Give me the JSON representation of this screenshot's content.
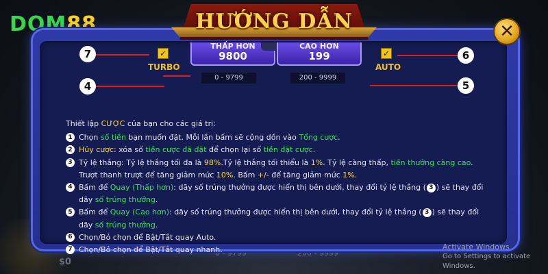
{
  "brand": {
    "part1": "DOM",
    "part2": "88"
  },
  "dialog": {
    "title": "HƯỚNG DẪN",
    "close_symbol": "✕"
  },
  "background": {
    "balance": "$0",
    "range_low": "0 - 9799",
    "range_high": "200 - 9999"
  },
  "demo": {
    "markers": [
      "7",
      "4",
      "6",
      "5"
    ],
    "turbo_label": "TURBO",
    "auto_label": "AUTO",
    "lower_button": {
      "label": "THẤP HƠN",
      "value": "9800",
      "range": "0 - 9799"
    },
    "higher_button": {
      "label": "CAO HƠN",
      "value": "199",
      "range": "200 - 9999"
    }
  },
  "instructions": {
    "intro": {
      "a": "Thiết lập ",
      "b": "CƯỢC",
      "c": " của bạn cho các giá trị:"
    },
    "item1": {
      "num": "1",
      "a": "Chọn ",
      "b": "số tiền",
      "c": " bạn muốn đặt. Mỗi lần bấm sẽ cộng dồn vào ",
      "d": "Tổng cược",
      "e": "."
    },
    "item2": {
      "num": "2",
      "a": "Hủy cược",
      "b": ": xóa số ",
      "c": "tiền cược đã đặt",
      "d": " để chọn lại số ",
      "e": "tiền đặt cược",
      "f": "."
    },
    "item3": {
      "num": "3",
      "a": "Tỷ lệ thắng: Tỷ lệ thắng tối đa là ",
      "b": "98%",
      "c": ".Tỷ lệ thắng tối thiểu là ",
      "d": "1%",
      "e": ". Tỷ lệ càng thấp, ",
      "f": "tiền thưởng càng cao",
      "g": ". Trượt thanh trượt để tăng giảm mức ",
      "h": "10%",
      "i": ". Bấm ",
      "j": "+/-",
      "k": " để tăng giảm mức ",
      "l": "1%",
      "m": "."
    },
    "item4": {
      "num": "4",
      "a": "Bấm để ",
      "b": "Quay (Thấp hơn)",
      "c": ": dãy số trúng thưởng được hiển thị bên dưới, thay đổi tỷ lệ thắng (",
      "ref": "3",
      "d": ") sẽ thay đổi dãy ",
      "e": "số trúng thưởng",
      "f": "."
    },
    "item5": {
      "num": "5",
      "a": "Bấm để ",
      "b": "Quay (Cao hơn)",
      "c": ": dãy số trúng thưởng được hiển thị bên dưới, thay đổi tỷ lệ thắng (",
      "ref": "3",
      "d": ") sẽ thay đổi dãy ",
      "e": "số trúng thưởng",
      "f": "."
    },
    "item6": {
      "num": "6",
      "text": "Chọn/Bỏ chọn để Bật/Tắt quay Auto."
    },
    "item7": {
      "num": "7",
      "text": "Chọn/Bỏ chọn để Bật/Tắt quay nhanh."
    }
  },
  "watermark": {
    "line1": "Activate Windows",
    "line2": "Go to Settings to activate Windows."
  },
  "colors": {
    "highlight_green": "#3fe05c",
    "highlight_yellow": "#ffd64a",
    "title_gold": "#ffd24a",
    "panel_blue": "#2e3aa8"
  }
}
